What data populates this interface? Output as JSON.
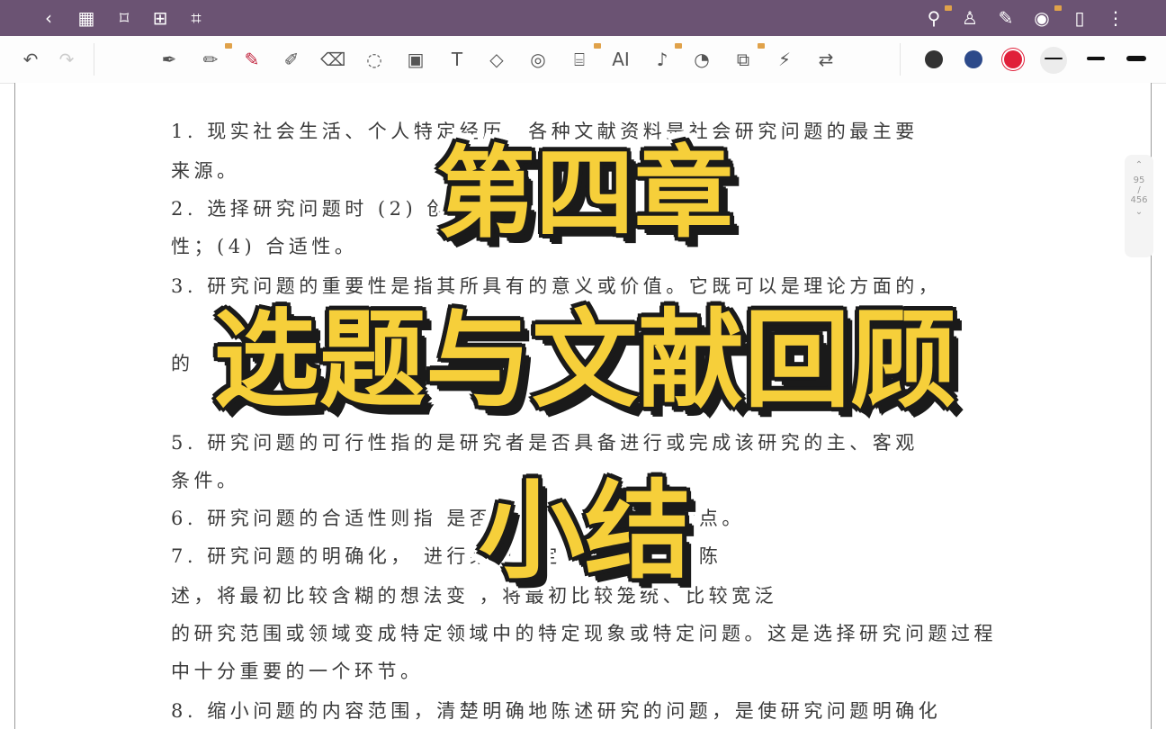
{
  "topbar": {
    "icons": [
      "back-icon",
      "grid-icon",
      "bookmark-icon",
      "add-page-icon",
      "crop-icon",
      "search-icon",
      "shirt-icon",
      "pen-icon",
      "eye-icon",
      "reader-icon",
      "more-icon"
    ]
  },
  "toolbar": {
    "tools": [
      "undo-icon",
      "redo-icon",
      "pen-icon",
      "pencil-icon",
      "marker-icon",
      "highlighter-icon",
      "eraser-icon",
      "lasso-icon",
      "image-icon",
      "text-box-icon",
      "shape-icon",
      "tape-icon",
      "text-recognition-icon",
      "ai-icon",
      "microphone-icon",
      "sticker-icon",
      "ocr-icon",
      "laser-icon",
      "translate-icon"
    ],
    "ai_label": "AI",
    "colors": [
      "#333333",
      "#2d4a8a",
      "#e0203a",
      "#1a1a1a"
    ]
  },
  "scroller": {
    "page": "95",
    "divider": "/",
    "total": "456"
  },
  "document": {
    "lines": [
      "1. 现实社会生活、个人特定经历、各种文献资料是社会研究问题的最主要",
      "来源。",
      "2. 选择研究问题时                              (2) 创造性；(3) 可行",
      "性；(4) 合适性。",
      "3. 研究问题的重要性是指其所具有的意义或价值。它既可以是理论方面的，",
      "                                                                  的",
      "",
      "5. 研究问题的可行性指的是研究者是否具备进行或完成该研究的主、客观",
      "条件。",
      "6. 研究问题的合适性则指              是否适合研究者的个人特点。",
      "7. 研究问题的明确化，             进行某种界定，给予明确的陈",
      "述，将最初比较含糊的想法变            ，将最初比较笼统、比较宽泛",
      "的研究范围或领域变成特定领域中的特定现象或特定问题。这是选择研究问题过程",
      "中十分重要的一个环节。",
      "8. 缩小问题的内容范围，清楚明确地陈述研究的问题，是使研究问题明确化"
    ]
  },
  "overlay": {
    "line1": "第四章",
    "line2": "选题与文献回顾",
    "line3": "小结"
  }
}
